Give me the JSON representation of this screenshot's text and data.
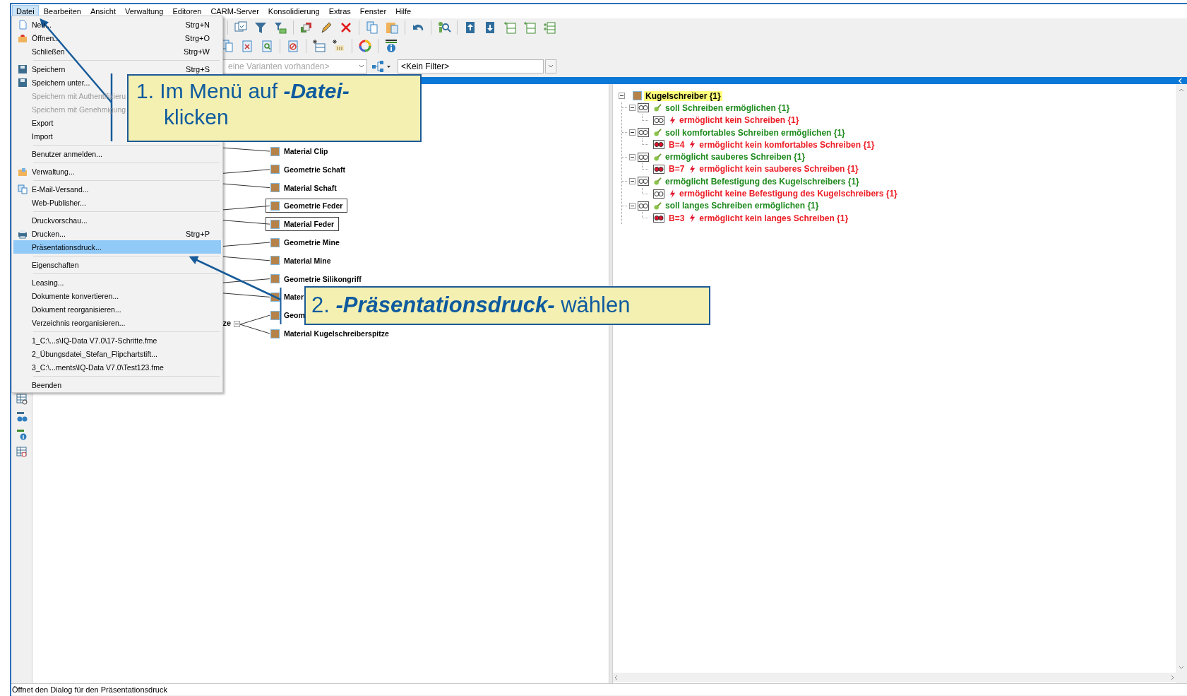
{
  "menu_bar": [
    {
      "label": "Datei",
      "selected": true
    },
    {
      "label": "Bearbeiten",
      "selected": false
    },
    {
      "label": "Ansicht",
      "selected": false
    },
    {
      "label": "Verwaltung",
      "selected": false
    },
    {
      "label": "Editoren",
      "selected": false
    },
    {
      "label": "CARM-Server",
      "selected": false
    },
    {
      "label": "Konsolidierung",
      "selected": false
    },
    {
      "label": "Extras",
      "selected": false
    },
    {
      "label": "Fenster",
      "selected": false
    },
    {
      "label": "Hilfe",
      "selected": false
    }
  ],
  "file_menu": [
    {
      "kind": "item",
      "label": "Neu...",
      "shortcut": "Strg+N",
      "disabled": false,
      "selected": false
    },
    {
      "kind": "item",
      "label": "Öffnen...",
      "shortcut": "Strg+O",
      "disabled": false,
      "selected": false
    },
    {
      "kind": "item",
      "label": "Schließen",
      "shortcut": "Strg+W",
      "disabled": false,
      "selected": false
    },
    {
      "kind": "separator"
    },
    {
      "kind": "item",
      "label": "Speichern",
      "shortcut": "Strg+S",
      "disabled": false,
      "selected": false
    },
    {
      "kind": "item",
      "label": "Speichern unter...",
      "disabled": false,
      "selected": false
    },
    {
      "kind": "item",
      "label": "Speichern mit Authentifizieru",
      "disabled": true,
      "selected": false
    },
    {
      "kind": "item",
      "label": "Speichern mit Genehmigung",
      "disabled": true,
      "selected": false
    },
    {
      "kind": "item",
      "label": "Export",
      "disabled": false,
      "selected": false
    },
    {
      "kind": "item",
      "label": "Import",
      "disabled": false,
      "selected": false
    },
    {
      "kind": "separator"
    },
    {
      "kind": "item",
      "label": "Benutzer anmelden...",
      "disabled": false,
      "selected": false
    },
    {
      "kind": "separator"
    },
    {
      "kind": "item",
      "label": "Verwaltung...",
      "disabled": false,
      "selected": false
    },
    {
      "kind": "separator"
    },
    {
      "kind": "item",
      "label": "E-Mail-Versand...",
      "disabled": false,
      "selected": false
    },
    {
      "kind": "item",
      "label": "Web-Publisher...",
      "disabled": false,
      "selected": false
    },
    {
      "kind": "separator"
    },
    {
      "kind": "item",
      "label": "Druckvorschau...",
      "disabled": false,
      "selected": false
    },
    {
      "kind": "item",
      "label": "Drucken...",
      "shortcut": "Strg+P",
      "disabled": false,
      "selected": false
    },
    {
      "kind": "item",
      "label": "Präsentationsdruck...",
      "disabled": false,
      "selected": true
    },
    {
      "kind": "separator"
    },
    {
      "kind": "item",
      "label": "Eigenschaften",
      "disabled": false,
      "selected": false
    },
    {
      "kind": "separator"
    },
    {
      "kind": "item",
      "label": "Leasing...",
      "disabled": false,
      "selected": false
    },
    {
      "kind": "item",
      "label": "Dokumente konvertieren...",
      "disabled": false,
      "selected": false
    },
    {
      "kind": "item",
      "label": "Dokument reorganisieren...",
      "disabled": false,
      "selected": false
    },
    {
      "kind": "item",
      "label": "Verzeichnis reorganisieren...",
      "disabled": false,
      "selected": false
    },
    {
      "kind": "separator"
    },
    {
      "kind": "item",
      "label": "1_C:\\...s\\IQ-Data V7.0\\17-Schritte.fme",
      "disabled": false,
      "selected": false
    },
    {
      "kind": "item",
      "label": "2_Übungsdatei_Stefan_Flipchartstift...",
      "disabled": false,
      "selected": false
    },
    {
      "kind": "item",
      "label": "3_C:\\...ments\\IQ-Data V7.0\\Test123.fme",
      "disabled": false,
      "selected": false
    },
    {
      "kind": "separator"
    },
    {
      "kind": "item",
      "label": "Beenden",
      "disabled": false,
      "selected": false
    }
  ],
  "variant_combo": {
    "value": "eine Varianten vorhanden>",
    "disabled": true
  },
  "filter_combo": {
    "value": "<Kein Filter>",
    "disabled": false
  },
  "diagram": {
    "branches": [
      {
        "children": [
          {
            "label": "Material Clip",
            "framed": false
          }
        ]
      },
      {
        "children": [
          {
            "label": "Geometrie Schaft",
            "framed": false
          },
          {
            "label": "Material Schaft",
            "framed": false
          }
        ]
      },
      {
        "children": [
          {
            "label": "Geometrie Feder",
            "framed": true
          },
          {
            "label": "Material Feder",
            "framed": true
          }
        ]
      },
      {
        "children": [
          {
            "label": "Geometrie Mine",
            "framed": false
          },
          {
            "label": "Material Mine",
            "framed": false
          }
        ]
      },
      {
        "children": [
          {
            "label": "Geometrie Silikongriff",
            "framed": false
          },
          {
            "label": "Mater",
            "framed": false
          }
        ]
      },
      {
        "label": "ze",
        "expanded": true,
        "children": [
          {
            "label": "Geom",
            "framed": false
          },
          {
            "label": "Material Kugelschreiberspitze",
            "framed": false
          }
        ]
      }
    ]
  },
  "tree": {
    "label": "Kugelschreiber {1}",
    "selected": true,
    "expanded": true,
    "children": [
      {
        "kind": "function",
        "label": "soll Schreiben ermöglichen {1}",
        "expanded": true,
        "children": [
          {
            "kind": "failure",
            "label": "ermöglicht kein Schreiben {1}"
          }
        ]
      },
      {
        "kind": "function",
        "label": "soll komfortables Schreiben ermöglichen {1}",
        "expanded": true,
        "children": [
          {
            "kind": "failure",
            "rating": "B=4",
            "label": "ermöglicht kein komfortables Schreiben {1}"
          }
        ]
      },
      {
        "kind": "function",
        "label": "ermöglicht sauberes Schreiben {1}",
        "expanded": true,
        "children": [
          {
            "kind": "failure",
            "rating": "B=7",
            "label": "ermöglicht kein sauberes Schreiben {1}"
          }
        ]
      },
      {
        "kind": "function",
        "label": "ermöglicht Befestigung des Kugelschreibers {1}",
        "expanded": true,
        "children": [
          {
            "kind": "failure",
            "label": "ermöglicht keine Befestigung des Kugelschreibers {1}"
          }
        ]
      },
      {
        "kind": "function",
        "label": "soll langes Schreiben ermöglichen {1}",
        "expanded": true,
        "children": [
          {
            "kind": "failure",
            "rating": "B=3",
            "label": "ermöglicht kein langes Schreiben {1}"
          }
        ]
      }
    ]
  },
  "status_bar": "Öffnet den Dialog für den Präsentationsdruck",
  "callouts": [
    {
      "text": "1. Im Menü auf **-Datei-** klicken"
    },
    {
      "text": "2. **-Präsentationsdruck-** wählen"
    }
  ]
}
